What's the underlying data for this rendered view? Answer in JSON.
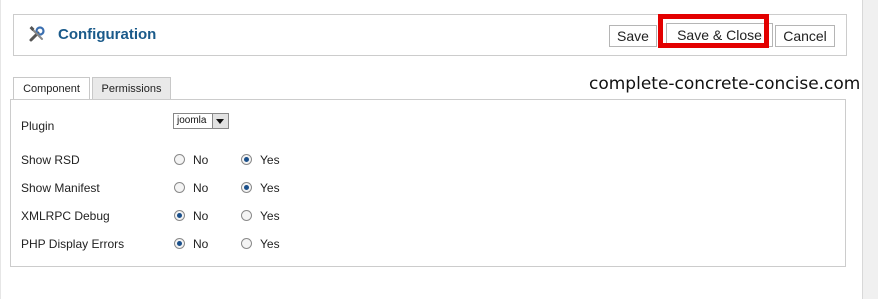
{
  "header": {
    "title": "Configuration",
    "icon": "wrench-screwdriver-icon",
    "buttons": {
      "save": "Save",
      "save_close": "Save & Close",
      "cancel": "Cancel"
    },
    "highlight_color": "#e30000"
  },
  "tabs": [
    {
      "label": "Component",
      "active": true
    },
    {
      "label": "Permissions",
      "active": false
    }
  ],
  "watermark": "complete-concrete-concise.com",
  "form": {
    "plugin": {
      "label": "Plugin",
      "selected": "joomla"
    },
    "options": [
      {
        "label": "Show RSD",
        "no_label": "No",
        "yes_label": "Yes",
        "value": "Yes"
      },
      {
        "label": "Show Manifest",
        "no_label": "No",
        "yes_label": "Yes",
        "value": "Yes"
      },
      {
        "label": "XMLRPC Debug",
        "no_label": "No",
        "yes_label": "Yes",
        "value": "No"
      },
      {
        "label": "PHP Display Errors",
        "no_label": "No",
        "yes_label": "Yes",
        "value": "No"
      }
    ]
  },
  "colors": {
    "title": "#1a5a8a",
    "radio_checked": "#1a4f8a"
  }
}
